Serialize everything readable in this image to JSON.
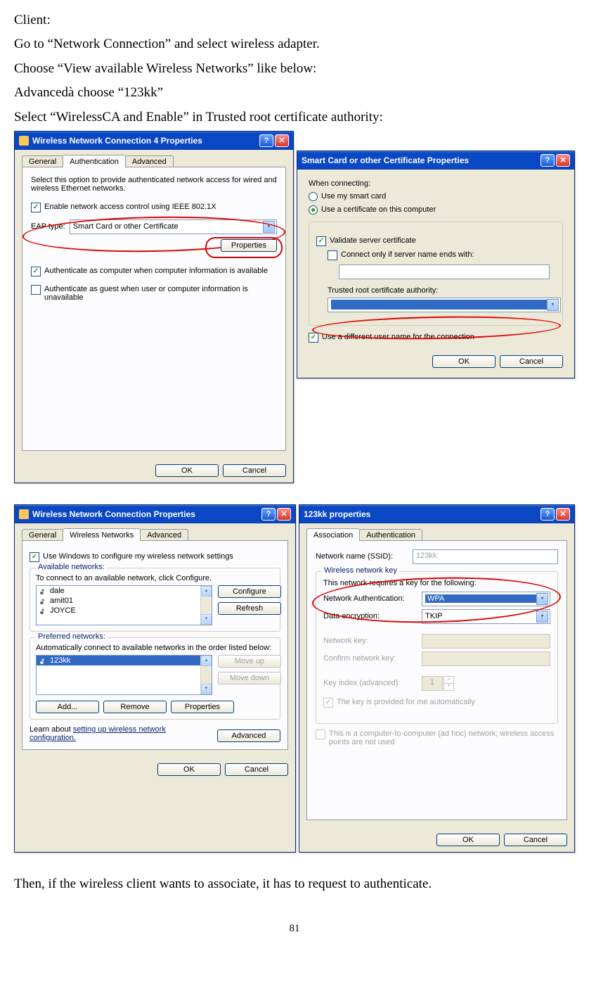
{
  "doc": {
    "p1": "Client:",
    "p2": "Go to “Network Connection” and select wireless adapter.",
    "p3": "Choose “View available Wireless Networks” like below:",
    "p4": "Advancedà  choose “123kk”",
    "p5": "Select “WirelessCA and Enable” in Trusted root certificate authority:",
    "p6": "Then, if the wireless client wants to associate, it has to request to authenticate.",
    "page": "81"
  },
  "dlg1": {
    "title": "Wireless Network Connection 4 Properties",
    "tabs": {
      "general": "General",
      "auth": "Authentication",
      "adv": "Advanced"
    },
    "desc": "Select this option to provide authenticated network access for wired and wireless Ethernet networks.",
    "chk1": "Enable network access control using IEEE 802.1X",
    "eap_label": "EAP type:",
    "eap_value": "Smart Card or other Certificate",
    "properties": "Properties",
    "chk2": "Authenticate as computer when computer information is available",
    "chk3": "Authenticate as guest when user or computer information is unavailable",
    "ok": "OK",
    "cancel": "Cancel"
  },
  "dlg2": {
    "title": "Smart Card or other Certificate Properties",
    "when": "When connecting:",
    "r1": "Use my smart card",
    "r2": "Use a certificate on this computer",
    "chk1": "Validate server certificate",
    "chk2": "Connect only if server name ends with:",
    "trusted": "Trusted root certificate authority:",
    "chk3": "Use a different user name for the connection",
    "ok": "OK",
    "cancel": "Cancel"
  },
  "dlg3": {
    "title": "Wireless Network Connection Properties",
    "tabs": {
      "general": "General",
      "wn": "Wireless Networks",
      "adv": "Advanced"
    },
    "chk_top": "Use Windows to configure my wireless network settings",
    "avail": {
      "legend": "Available networks:",
      "desc": "To connect to an available network, click Configure.",
      "items": [
        "dale",
        "amit01",
        "JOYCE"
      ],
      "configure": "Configure",
      "refresh": "Refresh"
    },
    "pref": {
      "legend": "Preferred networks:",
      "desc": "Automatically connect to available networks in the order listed below:",
      "items": [
        "123kk"
      ],
      "moveup": "Move up",
      "movedown": "Move down",
      "add": "Add...",
      "remove": "Remove",
      "properties": "Properties"
    },
    "learn1": "Learn about ",
    "learn2": "setting up wireless network configuration.",
    "advanced": "Advanced",
    "ok": "OK",
    "cancel": "Cancel"
  },
  "dlg4": {
    "title": "123kk properties",
    "tabs": {
      "assoc": "Association",
      "auth": "Authentication"
    },
    "ssid_label": "Network name (SSID):",
    "ssid_value": "123kk",
    "wnk": {
      "legend": "Wireless network key",
      "desc": "This network requires a key for the following:",
      "auth_label": "Network Authentication:",
      "auth_value": "WPA",
      "enc_label": "Data encryption:",
      "enc_value": "TKIP",
      "nk": "Network key:",
      "cnk": "Confirm network key:",
      "ki": "Key index (advanced):",
      "ki_val": "1",
      "auto": "The key is provided for me automatically"
    },
    "adhoc": "This is a computer-to-computer (ad hoc) network; wireless access points are not used",
    "ok": "OK",
    "cancel": "Cancel"
  }
}
